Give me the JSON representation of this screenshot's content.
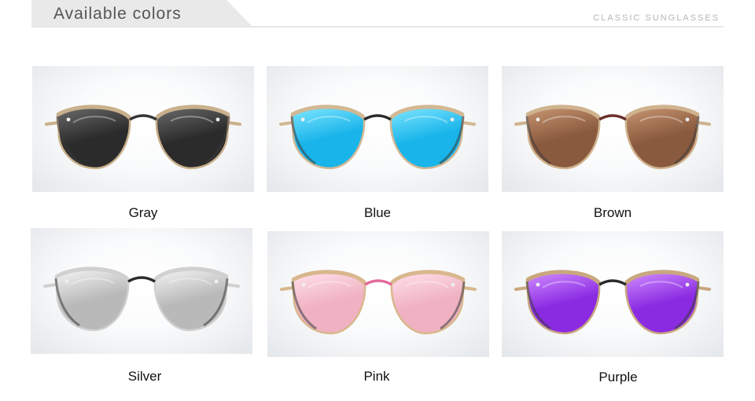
{
  "header": {
    "title": "Available colors",
    "subtitle": "CLASSIC SUNGLASSES"
  },
  "products": [
    {
      "name": "Gray",
      "lens_color": "#2b2b2b",
      "lens_highlight": "#6a6a6a",
      "bridge_color": "#333333",
      "frame_color": "#c9b08c"
    },
    {
      "name": "Blue",
      "lens_color": "#18b4ea",
      "lens_highlight": "#7fe6ff",
      "bridge_color": "#2a2a2a",
      "frame_color": "#d2b894"
    },
    {
      "name": "Brown",
      "lens_color": "#8a5a3e",
      "lens_highlight": "#c79572",
      "bridge_color": "#6b2e2a",
      "frame_color": "#cfb28e"
    },
    {
      "name": "Silver",
      "lens_color": "#b9b9b9",
      "lens_highlight": "#f4f4f4",
      "bridge_color": "#2a2a2a",
      "frame_color": "#d0d0d0"
    },
    {
      "name": "Pink",
      "lens_color": "#f0b2c2",
      "lens_highlight": "#ffe0ea",
      "bridge_color": "#e26a98",
      "frame_color": "#d9b78e"
    },
    {
      "name": "Purple",
      "lens_color": "#8a2be2",
      "lens_highlight": "#d08cff",
      "bridge_color": "#2a2a2a",
      "frame_color": "#c9a77f"
    }
  ]
}
